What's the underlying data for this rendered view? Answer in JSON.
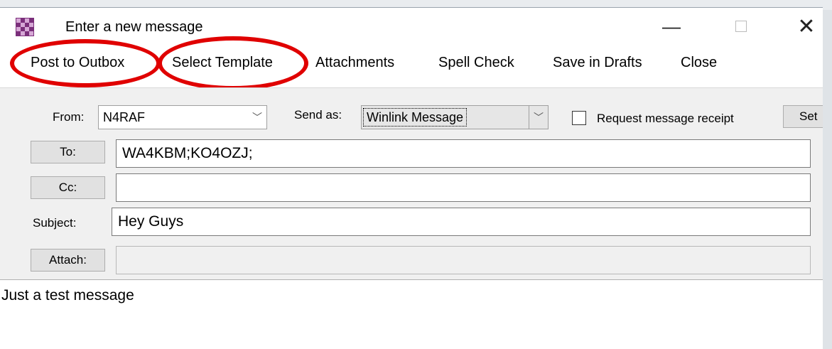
{
  "window": {
    "title": "Enter a new message",
    "icons": {
      "app": "checkered-app-icon",
      "minimize": "minimize-icon",
      "maximize": "maximize-icon",
      "close": "close-icon"
    },
    "minimize_glyph": "—",
    "close_glyph": "✕"
  },
  "menu": {
    "items": [
      {
        "label": "Post to Outbox"
      },
      {
        "label": "Select Template"
      },
      {
        "label": "Attachments"
      },
      {
        "label": "Spell Check"
      },
      {
        "label": "Save in Drafts"
      },
      {
        "label": "Close"
      }
    ]
  },
  "annotations": {
    "highlight_color": "#e00000"
  },
  "form": {
    "from_label": "From:",
    "from_value": "N4RAF",
    "send_as_label": "Send as:",
    "send_as_value": "Winlink Message",
    "receipt_label": "Request message receipt",
    "receipt_checked": false,
    "set_label": "Set",
    "to_button": "To:",
    "to_value": "WA4KBM;KO4OZJ;",
    "cc_button": "Cc:",
    "cc_value": "",
    "subject_label": "Subject:",
    "subject_value": "Hey Guys",
    "attach_button": "Attach:",
    "attach_value": ""
  },
  "body": {
    "text": "Just a test message"
  }
}
